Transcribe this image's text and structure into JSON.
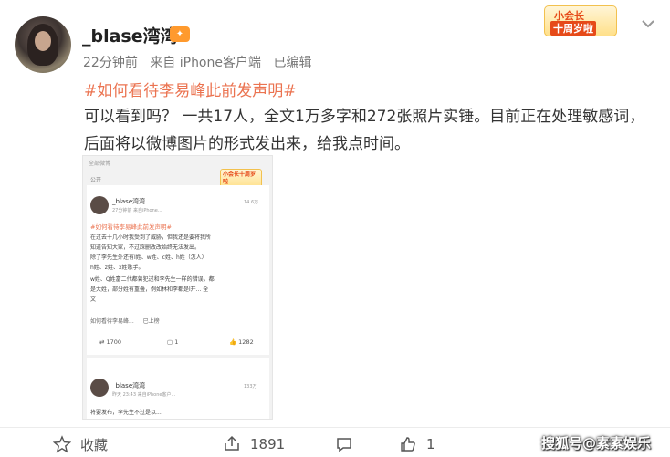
{
  "post": {
    "username": "_blase湾湾",
    "vip_icon_text": "🎭",
    "meta": {
      "time": "22分钟前",
      "source": "来自 iPhone客户端",
      "edited": "已编辑"
    },
    "badge": {
      "line1": "小会长",
      "line2": "十周岁啦"
    },
    "topic": "#如何看待李易峰此前发声明#",
    "content": "可以看到吗？ 一共17人，全文1万多字和272张照片实锤。目前正在处理敏感词，后面将以微博图片的形式发出来，给我点时间。"
  },
  "embedded": {
    "top_label": "全部微博",
    "lock_label": "公开",
    "badge": "小会长十周岁啦",
    "card1": {
      "username": "_blase湾湾",
      "time": "27分钟前  来自iPhone...",
      "count": "14.6万",
      "topic": "#如何看待李易峰此前发声明#",
      "lines": [
        "在过去十几小时我受到了威胁，但我还是要将我所",
        "知道告知大家，不过踩删改改始终无法发出。",
        "除了李先生外还有I姓、w姓、c姓、h姓（怎人）",
        "h姓、z姓、x姓歌手。",
        "w姓、Q姓富二代都曾犯过和李先生一样的错误，都",
        "是大姓，部分姓有重叠，例如林和李都是l开...  全",
        "文"
      ],
      "tag": "如何看待李易峰...",
      "tag_extra": "已上榜",
      "repost": "1700",
      "comment": "1",
      "like": "1282"
    },
    "card2": {
      "username": "_blase湾湾",
      "time": "昨天 23:43  来自iPhone客户...",
      "count": "133万",
      "line": "将要发布，李先生不过是以..."
    }
  },
  "bottom_bar": {
    "favorite_label": "收藏",
    "repost_count": "1891",
    "comment_count": "",
    "like_count": "1"
  },
  "watermark": "搜狐号@素素娱乐",
  "colors": {
    "topic": "#eb7350",
    "badge_bg": "#ffe08a",
    "text": "#333333",
    "meta": "#777777"
  }
}
